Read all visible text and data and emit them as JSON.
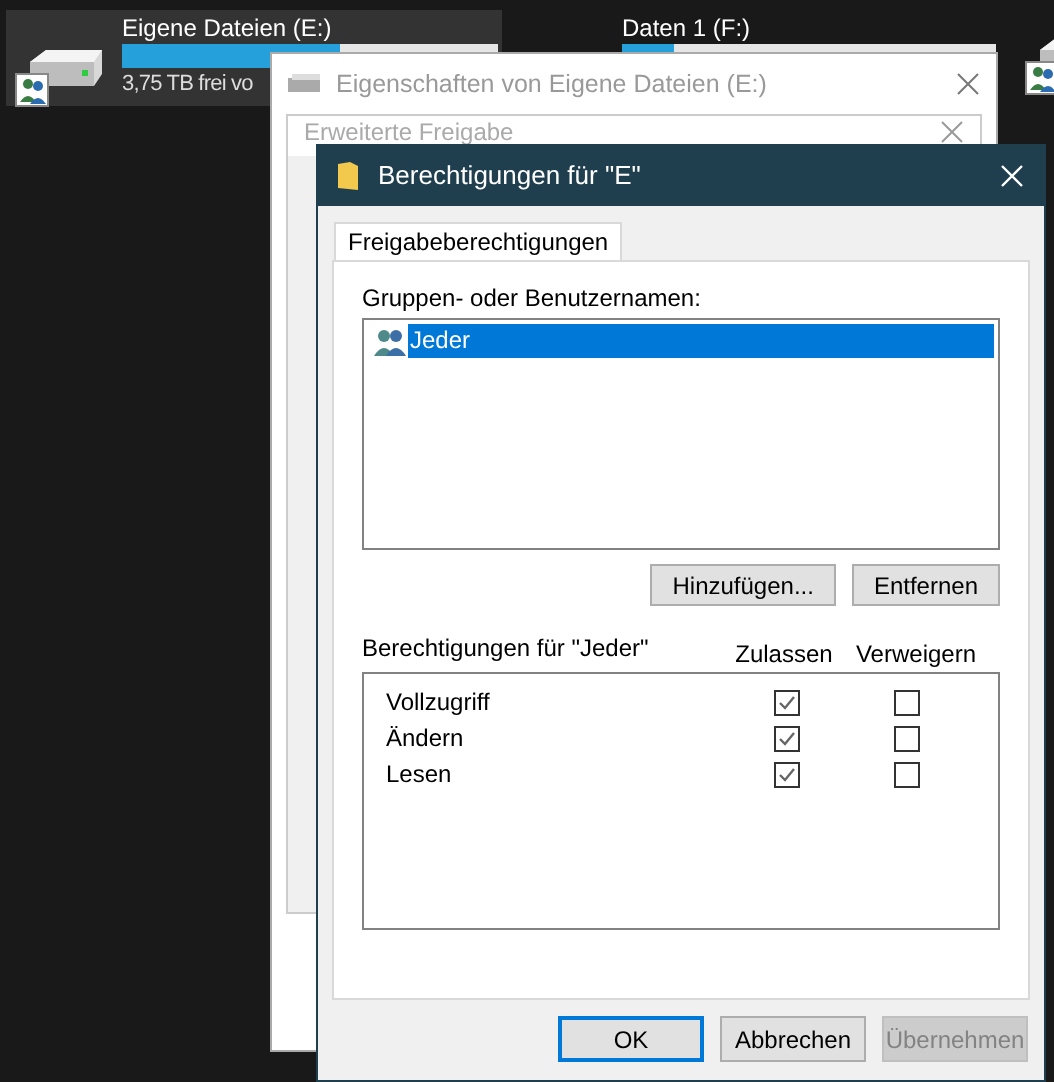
{
  "drives": [
    {
      "name": "Eigene Dateien (E:)",
      "free": "3,75 TB frei vo",
      "level": 0.58,
      "selected": true
    },
    {
      "name": "Daten 1 (F:)",
      "level": 0.14,
      "selected": false
    }
  ],
  "back_windows": [
    {
      "title": "Eigenschaften von Eigene Dateien (E:)"
    },
    {
      "title": "Erweiterte Freigabe"
    }
  ],
  "dialog": {
    "title": "Berechtigungen für \"E\"",
    "tabs": [
      {
        "label": "Freigabeberechtigungen",
        "selected": true
      }
    ],
    "groups_label": "Gruppen- oder Benutzernamen:",
    "users": [
      {
        "name": "Jeder",
        "selected": true
      }
    ],
    "user_buttons": [
      "Hinzufügen...",
      "Entfernen"
    ],
    "permissions_label": "Berechtigungen für \"Jeder\"",
    "columns": [
      "Zulassen",
      "Verweigern"
    ],
    "permissions": [
      {
        "name": "Vollzugriff",
        "allow": true,
        "deny": false
      },
      {
        "name": "Ändern",
        "allow": true,
        "deny": false
      },
      {
        "name": "Lesen",
        "allow": true,
        "deny": false
      }
    ],
    "buttons": [
      {
        "label": "OK",
        "default": true,
        "disabled": false
      },
      {
        "label": "Abbrechen",
        "default": false,
        "disabled": false
      },
      {
        "label": "Übernehmen",
        "default": false,
        "disabled": true
      }
    ]
  }
}
